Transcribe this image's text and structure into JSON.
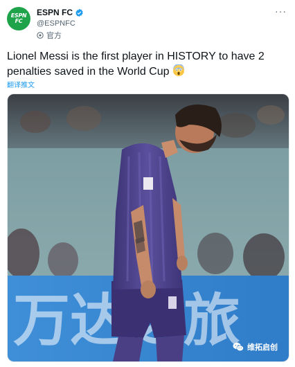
{
  "account": {
    "avatar_text_line1": "ESPN",
    "avatar_text_line2": "FC",
    "name": "ESPN FC",
    "handle": "@ESPNFC",
    "label": "官方",
    "verified": true
  },
  "menu": {
    "more_label": "···"
  },
  "tweet": {
    "text": "Lionel Messi is the first player in HISTORY to have 2 penalties saved in the World Cup",
    "emoji": "screaming-face-emoji",
    "translate_label": "翻译推文"
  },
  "media": {
    "banner_text": "万达之旅",
    "watermark_text": "维拓启创"
  },
  "colors": {
    "brand_green": "#1ea34a",
    "link_blue": "#1d9bf0",
    "secondary_text": "#536471",
    "kit_purple": "#5a4f9c"
  }
}
